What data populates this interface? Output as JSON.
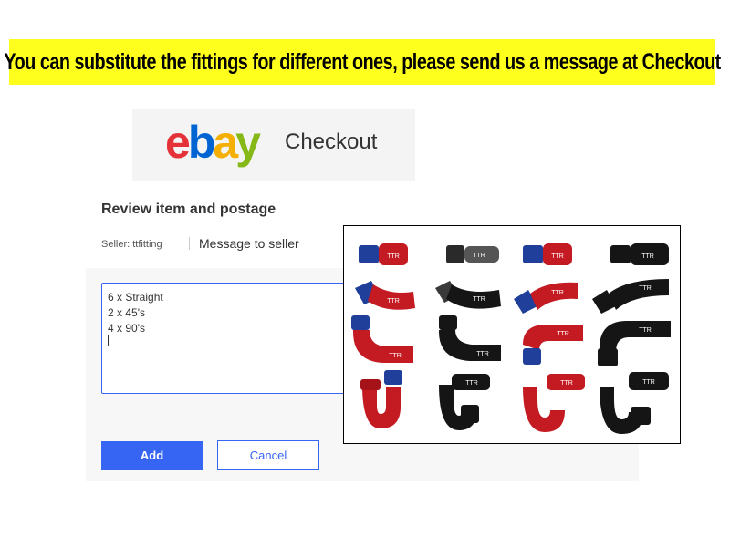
{
  "banner": {
    "text": "You can substitute the fittings for different ones, please send us a message at Checkout"
  },
  "header": {
    "logo_text": "ebay",
    "title": "Checkout"
  },
  "review": {
    "title": "Review item and postage",
    "seller_label": "Seller: ttfitting",
    "message_link": "Message to seller",
    "message_lines": [
      "6 x Straight",
      "2 x 45's",
      "4 x 90's"
    ],
    "add_label": "Add",
    "cancel_label": "Cancel"
  },
  "photo": {
    "fitting_label": "TTR",
    "colors": {
      "red": "#c41a22",
      "blue": "#1f3f9a",
      "black": "#151515"
    }
  }
}
